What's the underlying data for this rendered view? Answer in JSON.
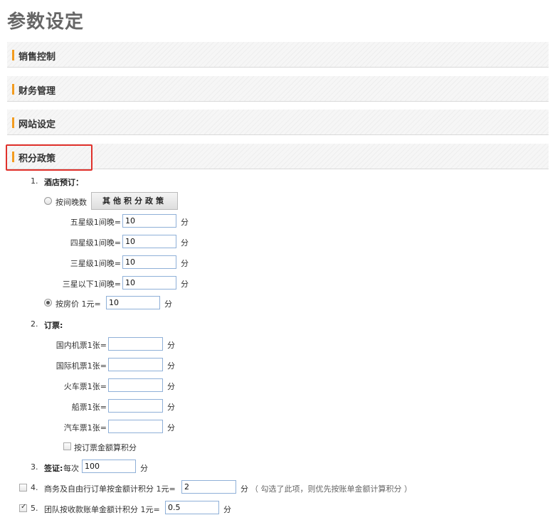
{
  "page": {
    "title": "参数设定"
  },
  "sections": [
    {
      "label": "销售控制"
    },
    {
      "label": "财务管理"
    },
    {
      "label": "网站设定"
    },
    {
      "label": "积分政策"
    }
  ],
  "accent_color": "#f39c1f",
  "highlight_color": "#e0312b",
  "unit": "分",
  "hotel": {
    "number": "1.",
    "title": "酒店预订：",
    "by_night_label": "按间晚数",
    "by_night_selected": false,
    "other_policy_button": "其他积分政策",
    "rows": [
      {
        "label": "五星级1间晚=",
        "value": "10"
      },
      {
        "label": "四星级1间晚=",
        "value": "10"
      },
      {
        "label": "三星级1间晚=",
        "value": "10"
      },
      {
        "label": "三星以下1间晚=",
        "value": "10"
      }
    ],
    "by_price_label": "按房价  1元=",
    "by_price_selected": true,
    "by_price_value": "10"
  },
  "ticket": {
    "number": "2.",
    "title": "订票:",
    "rows": [
      {
        "label": "国内机票1张=",
        "value": ""
      },
      {
        "label": "国际机票1张=",
        "value": ""
      },
      {
        "label": "火车票1张=",
        "value": ""
      },
      {
        "label": "船票1张=",
        "value": ""
      },
      {
        "label": "汽车票1张=",
        "value": ""
      }
    ],
    "amount_checkbox_label": "按订票金额算积分",
    "amount_checked": false
  },
  "visa": {
    "number": "3.",
    "title": "签证:",
    "per_label": "每次",
    "value": "100"
  },
  "business": {
    "number": "4.",
    "label": "商务及自由行订单按金额计积分 1元=",
    "value": "2",
    "checked": false,
    "hint": "（ 勾选了此项，则优先按账单金额计算积分 ）"
  },
  "group": {
    "number": "5.",
    "label": "团队按收款账单金额计积分 1元=",
    "value": "0.5",
    "checked": true
  }
}
